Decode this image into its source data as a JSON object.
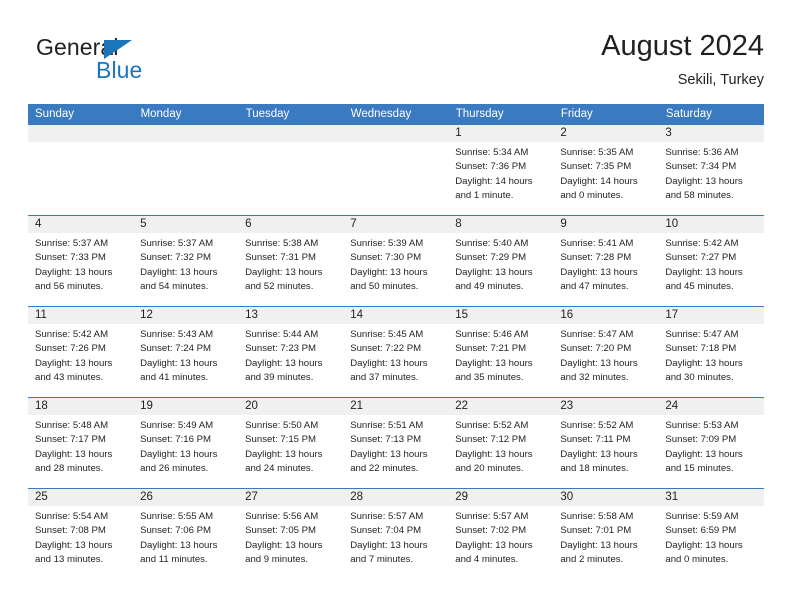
{
  "brand": {
    "name_top": "General",
    "name_bottom": "Blue",
    "accent_color": "#1b75bb"
  },
  "header": {
    "title": "August 2024",
    "subtitle": "Sekili, Turkey"
  },
  "theme": {
    "header_blue": "#3a7ac0",
    "daynum_band": "#f0f0f0",
    "text": "#231f20"
  },
  "weekday_headers": [
    "Sunday",
    "Monday",
    "Tuesday",
    "Wednesday",
    "Thursday",
    "Friday",
    "Saturday"
  ],
  "weeks": [
    [
      {
        "day": "",
        "lines": [
          "",
          "",
          "",
          ""
        ]
      },
      {
        "day": "",
        "lines": [
          "",
          "",
          "",
          ""
        ]
      },
      {
        "day": "",
        "lines": [
          "",
          "",
          "",
          ""
        ]
      },
      {
        "day": "",
        "lines": [
          "",
          "",
          "",
          ""
        ]
      },
      {
        "day": "1",
        "lines": [
          "Sunrise: 5:34 AM",
          "Sunset: 7:36 PM",
          "Daylight: 14 hours",
          "and 1 minute."
        ]
      },
      {
        "day": "2",
        "lines": [
          "Sunrise: 5:35 AM",
          "Sunset: 7:35 PM",
          "Daylight: 14 hours",
          "and 0 minutes."
        ]
      },
      {
        "day": "3",
        "lines": [
          "Sunrise: 5:36 AM",
          "Sunset: 7:34 PM",
          "Daylight: 13 hours",
          "and 58 minutes."
        ]
      }
    ],
    [
      {
        "day": "4",
        "lines": [
          "Sunrise: 5:37 AM",
          "Sunset: 7:33 PM",
          "Daylight: 13 hours",
          "and 56 minutes."
        ]
      },
      {
        "day": "5",
        "lines": [
          "Sunrise: 5:37 AM",
          "Sunset: 7:32 PM",
          "Daylight: 13 hours",
          "and 54 minutes."
        ]
      },
      {
        "day": "6",
        "lines": [
          "Sunrise: 5:38 AM",
          "Sunset: 7:31 PM",
          "Daylight: 13 hours",
          "and 52 minutes."
        ]
      },
      {
        "day": "7",
        "lines": [
          "Sunrise: 5:39 AM",
          "Sunset: 7:30 PM",
          "Daylight: 13 hours",
          "and 50 minutes."
        ]
      },
      {
        "day": "8",
        "lines": [
          "Sunrise: 5:40 AM",
          "Sunset: 7:29 PM",
          "Daylight: 13 hours",
          "and 49 minutes."
        ]
      },
      {
        "day": "9",
        "lines": [
          "Sunrise: 5:41 AM",
          "Sunset: 7:28 PM",
          "Daylight: 13 hours",
          "and 47 minutes."
        ]
      },
      {
        "day": "10",
        "lines": [
          "Sunrise: 5:42 AM",
          "Sunset: 7:27 PM",
          "Daylight: 13 hours",
          "and 45 minutes."
        ]
      }
    ],
    [
      {
        "day": "11",
        "lines": [
          "Sunrise: 5:42 AM",
          "Sunset: 7:26 PM",
          "Daylight: 13 hours",
          "and 43 minutes."
        ]
      },
      {
        "day": "12",
        "lines": [
          "Sunrise: 5:43 AM",
          "Sunset: 7:24 PM",
          "Daylight: 13 hours",
          "and 41 minutes."
        ]
      },
      {
        "day": "13",
        "lines": [
          "Sunrise: 5:44 AM",
          "Sunset: 7:23 PM",
          "Daylight: 13 hours",
          "and 39 minutes."
        ]
      },
      {
        "day": "14",
        "lines": [
          "Sunrise: 5:45 AM",
          "Sunset: 7:22 PM",
          "Daylight: 13 hours",
          "and 37 minutes."
        ]
      },
      {
        "day": "15",
        "lines": [
          "Sunrise: 5:46 AM",
          "Sunset: 7:21 PM",
          "Daylight: 13 hours",
          "and 35 minutes."
        ]
      },
      {
        "day": "16",
        "lines": [
          "Sunrise: 5:47 AM",
          "Sunset: 7:20 PM",
          "Daylight: 13 hours",
          "and 32 minutes."
        ]
      },
      {
        "day": "17",
        "lines": [
          "Sunrise: 5:47 AM",
          "Sunset: 7:18 PM",
          "Daylight: 13 hours",
          "and 30 minutes."
        ]
      }
    ],
    [
      {
        "day": "18",
        "lines": [
          "Sunrise: 5:48 AM",
          "Sunset: 7:17 PM",
          "Daylight: 13 hours",
          "and 28 minutes."
        ]
      },
      {
        "day": "19",
        "lines": [
          "Sunrise: 5:49 AM",
          "Sunset: 7:16 PM",
          "Daylight: 13 hours",
          "and 26 minutes."
        ]
      },
      {
        "day": "20",
        "lines": [
          "Sunrise: 5:50 AM",
          "Sunset: 7:15 PM",
          "Daylight: 13 hours",
          "and 24 minutes."
        ]
      },
      {
        "day": "21",
        "lines": [
          "Sunrise: 5:51 AM",
          "Sunset: 7:13 PM",
          "Daylight: 13 hours",
          "and 22 minutes."
        ]
      },
      {
        "day": "22",
        "lines": [
          "Sunrise: 5:52 AM",
          "Sunset: 7:12 PM",
          "Daylight: 13 hours",
          "and 20 minutes."
        ]
      },
      {
        "day": "23",
        "lines": [
          "Sunrise: 5:52 AM",
          "Sunset: 7:11 PM",
          "Daylight: 13 hours",
          "and 18 minutes."
        ]
      },
      {
        "day": "24",
        "lines": [
          "Sunrise: 5:53 AM",
          "Sunset: 7:09 PM",
          "Daylight: 13 hours",
          "and 15 minutes."
        ]
      }
    ],
    [
      {
        "day": "25",
        "lines": [
          "Sunrise: 5:54 AM",
          "Sunset: 7:08 PM",
          "Daylight: 13 hours",
          "and 13 minutes."
        ]
      },
      {
        "day": "26",
        "lines": [
          "Sunrise: 5:55 AM",
          "Sunset: 7:06 PM",
          "Daylight: 13 hours",
          "and 11 minutes."
        ]
      },
      {
        "day": "27",
        "lines": [
          "Sunrise: 5:56 AM",
          "Sunset: 7:05 PM",
          "Daylight: 13 hours",
          "and 9 minutes."
        ]
      },
      {
        "day": "28",
        "lines": [
          "Sunrise: 5:57 AM",
          "Sunset: 7:04 PM",
          "Daylight: 13 hours",
          "and 7 minutes."
        ]
      },
      {
        "day": "29",
        "lines": [
          "Sunrise: 5:57 AM",
          "Sunset: 7:02 PM",
          "Daylight: 13 hours",
          "and 4 minutes."
        ]
      },
      {
        "day": "30",
        "lines": [
          "Sunrise: 5:58 AM",
          "Sunset: 7:01 PM",
          "Daylight: 13 hours",
          "and 2 minutes."
        ]
      },
      {
        "day": "31",
        "lines": [
          "Sunrise: 5:59 AM",
          "Sunset: 6:59 PM",
          "Daylight: 13 hours",
          "and 0 minutes."
        ]
      }
    ]
  ]
}
